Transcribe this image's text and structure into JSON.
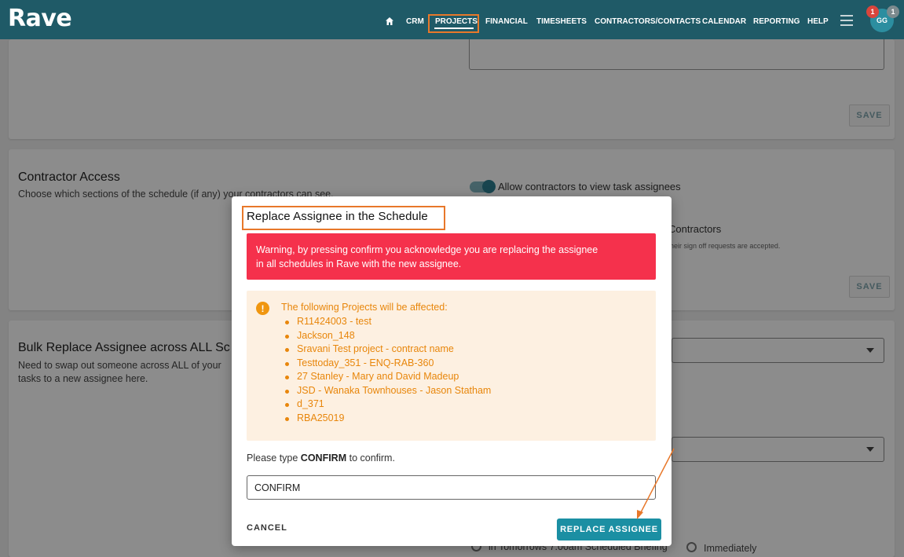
{
  "app": {
    "logo": "Rave"
  },
  "nav": {
    "items": [
      "CRM",
      "PROJECTS",
      "FINANCIAL",
      "TIMESHEETS",
      "CONTRACTORS/CONTACTS",
      "CALENDAR",
      "REPORTING",
      "HELP"
    ],
    "active": "PROJECTS",
    "home_icon": "home-icon",
    "menu_icon": "hamburger-icon"
  },
  "user": {
    "initials": "GG",
    "notification_count": "1",
    "secondary_count": "1"
  },
  "cards": {
    "save_label": "SAVE",
    "contractor_access": {
      "title": "Contractor Access",
      "description": "Choose which sections of the schedule (if any) your contractors can see.",
      "toggle_label": "Allow contractors to view task assignees",
      "partial_option": "Contractors",
      "partial_note": "heir sign off requests are accepted."
    },
    "bulk_replace": {
      "title": "Bulk Replace Assignee across ALL Sc",
      "description_line1": "Need to swap out someone across ALL of your",
      "description_line2": "tasks to a new assignee here.",
      "radio_partial": "in Tomorrows 7:00am Scheduled Briefing",
      "radio_immediately": "Immediately"
    }
  },
  "modal": {
    "title": "Replace Assignee in the Schedule",
    "warning": "Warning, by pressing confirm you acknowledge you are replacing the assignee in all schedules in Rave with the new assignee.",
    "warning_line1": "Warning, by pressing confirm you acknowledge you are replacing the assignee",
    "warning_line2": "in all schedules in Rave with the new assignee.",
    "info_heading": "The following Projects will be affected:",
    "projects": [
      "R11424003 - test",
      "Jackson_148",
      "Sravani Test project - contract name",
      "Testtoday_351 - ENQ-RAB-360",
      "27 Stanley - Mary and David Madeup",
      "JSD - Wanaka Townhouses - Jason Statham",
      "d_371",
      "RBA25019"
    ],
    "confirm_prefix": "Please type ",
    "confirm_keyword": "CONFIRM",
    "confirm_suffix": " to confirm.",
    "input_value": "CONFIRM",
    "cancel_label": "CANCEL",
    "replace_label": "REPLACE ASSIGNEE"
  },
  "colors": {
    "header": "#1f5a67",
    "accent": "#1b8fa3",
    "warning": "#f5314c",
    "info_bg": "#fdf0e1",
    "info_text": "#e8860b",
    "highlight": "#e8782a"
  }
}
